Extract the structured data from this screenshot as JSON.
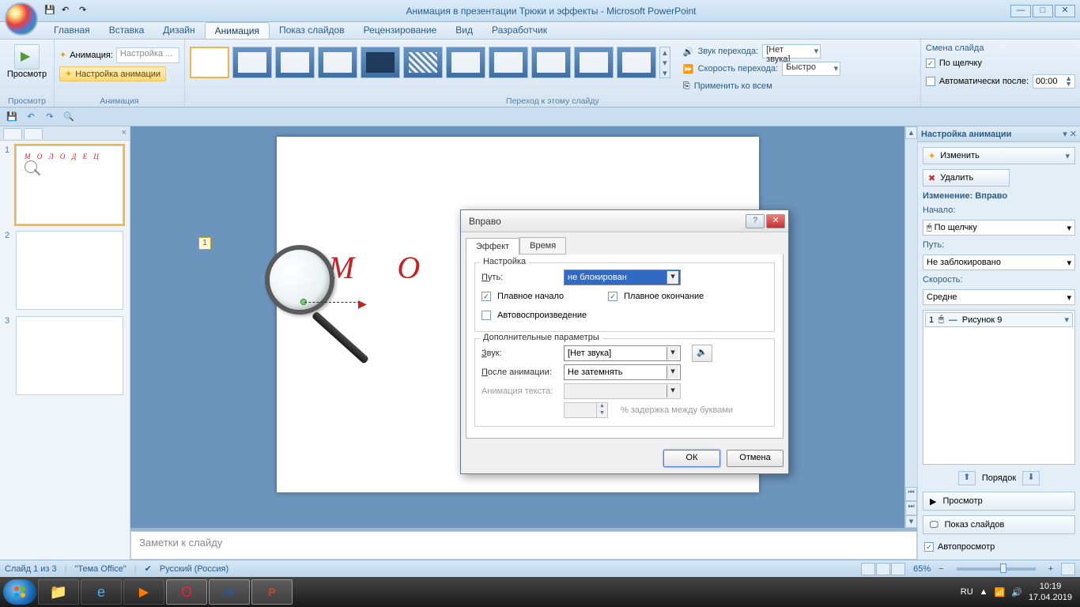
{
  "window": {
    "title": "Анимация в презентации Трюки и эффекты - Microsoft PowerPoint"
  },
  "tabs": {
    "home": "Главная",
    "insert": "Вставка",
    "design": "Дизайн",
    "animation": "Анимация",
    "slideshow": "Показ слайдов",
    "review": "Рецензирование",
    "view": "Вид",
    "developer": "Разработчик"
  },
  "ribbon": {
    "preview_group": "Просмотр",
    "preview_btn": "Просмотр",
    "anim_group": "Анимация",
    "anim_dd_label": "Анимация:",
    "anim_dd_value": "Настройка ...",
    "anim_settings_btn": "Настройка анимации",
    "transition_group": "Переход к этому слайду",
    "sound_label": "Звук перехода:",
    "sound_value": "[Нет звука]",
    "speed_label": "Скорость перехода:",
    "speed_value": "Быстро",
    "apply_all": "Применить ко всем",
    "advance_heading": "Смена слайда",
    "on_click": "По щелчку",
    "auto_after": "Автоматически после:",
    "auto_time": "00:00"
  },
  "thumbs": {
    "n1": "1",
    "n2": "2",
    "n3": "3",
    "text": "М О Л О Д Е Ц"
  },
  "slide": {
    "tag": "1",
    "text": "М О Л"
  },
  "notes": {
    "placeholder": "Заметки к слайду"
  },
  "taskpane": {
    "title": "Настройка анимации",
    "change_btn": "Изменить",
    "remove_btn": "Удалить",
    "mod_heading": "Изменение: Вправо",
    "start_label": "Начало:",
    "start_value": "По щелчку",
    "path_label": "Путь:",
    "path_value": "Не заблокировано",
    "speed_label": "Скорость:",
    "speed_value": "Средне",
    "item_num": "1",
    "item_name": "Рисунок 9",
    "order_label": "Порядок",
    "play_btn": "Просмотр",
    "slideshow_btn": "Показ слайдов",
    "autoplay": "Автопросмотр"
  },
  "dialog": {
    "title": "Вправо",
    "tab_effect": "Эффект",
    "tab_time": "Время",
    "fs_settings": "Настройка",
    "path_label": "Путь:",
    "path_value": "не блокирован",
    "smooth_start": "Плавное начало",
    "smooth_end": "Плавное окончание",
    "autoreverse": "Автовоспроизведение",
    "fs_extra": "Дополнительные параметры",
    "sound_label": "Звук:",
    "sound_value": "[Нет звука]",
    "after_label": "После анимации:",
    "after_value": "Не затемнять",
    "text_label": "Анимация текста:",
    "delay_label": "% задержка между буквами",
    "ok": "ОК",
    "cancel": "Отмена"
  },
  "status": {
    "slide": "Слайд 1 из 3",
    "theme": "\"Тема Office\"",
    "lang": "Русский (Россия)",
    "zoom": "65%"
  },
  "tray": {
    "lang": "RU",
    "time": "10:19",
    "date": "17.04.2019"
  }
}
